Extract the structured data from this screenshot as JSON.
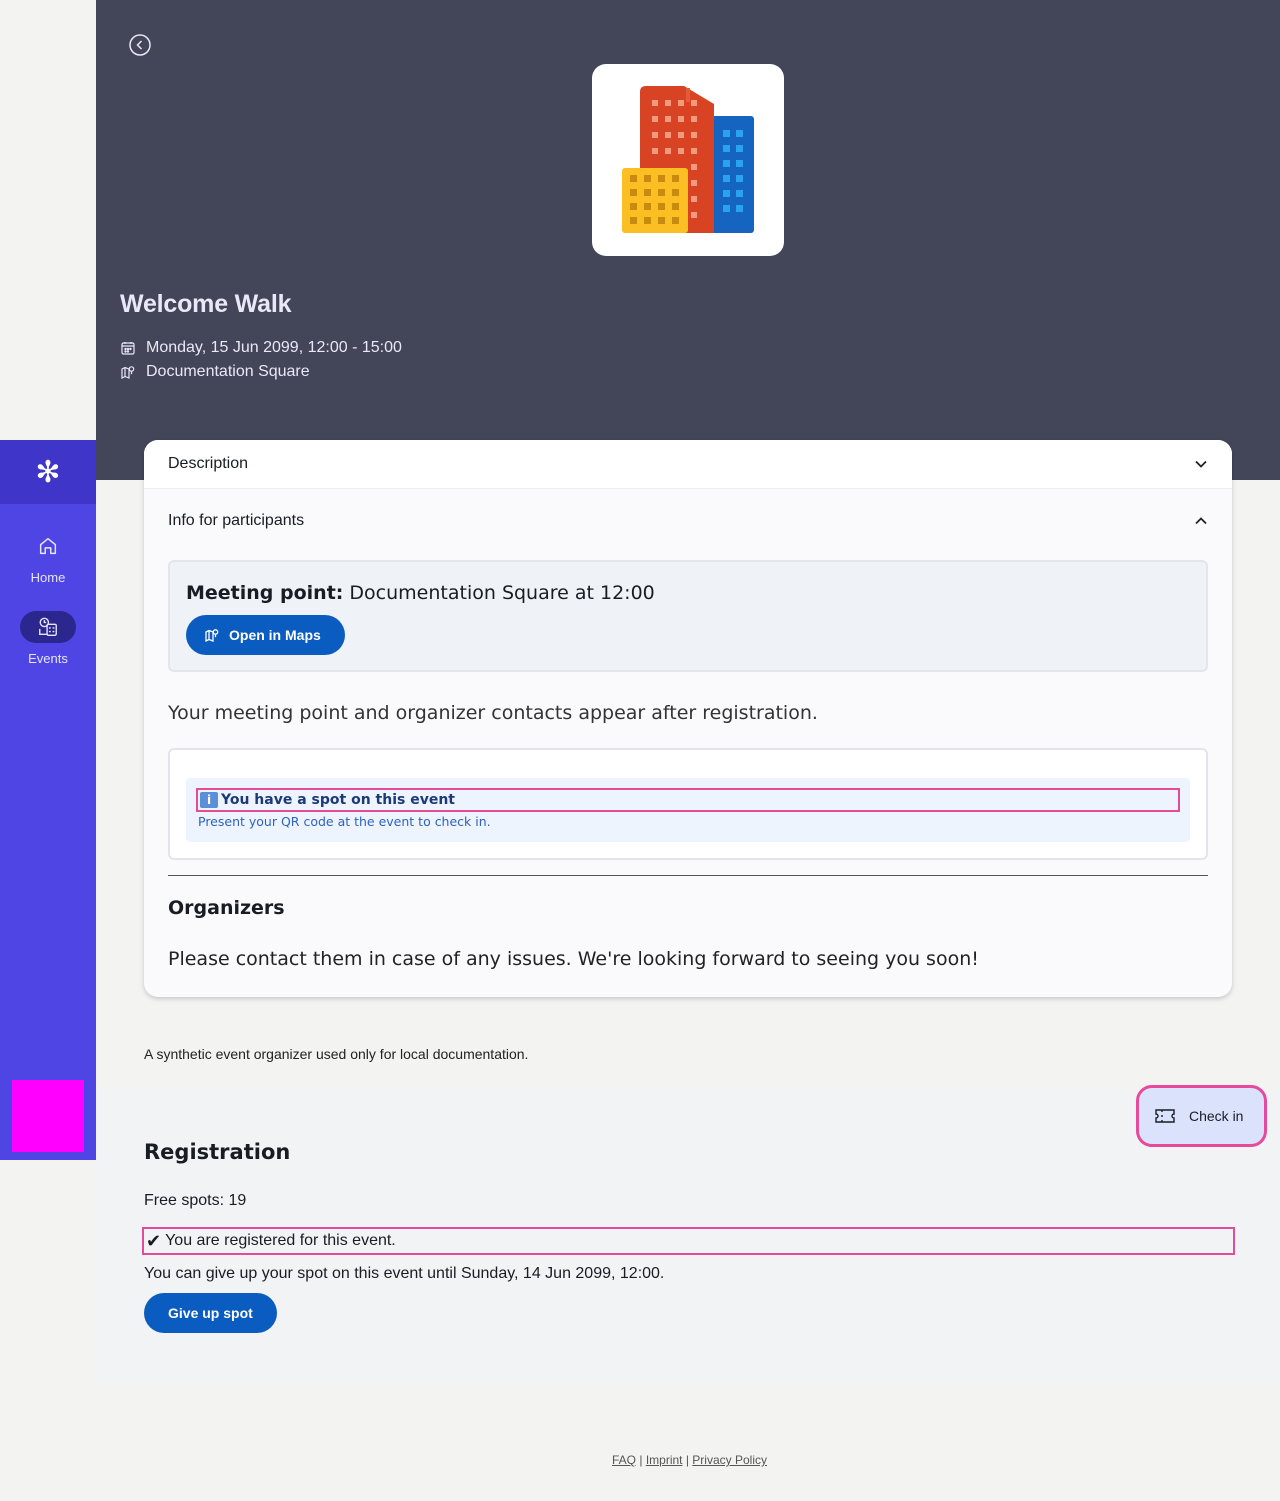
{
  "sidebar": {
    "logo": "✻",
    "items": [
      {
        "label": "Home",
        "icon": "home-icon"
      },
      {
        "label": "Events",
        "icon": "events-icon"
      }
    ]
  },
  "event": {
    "title": "Welcome Walk",
    "date": "Monday, 15 Jun 2099, 12:00 - 15:00",
    "location": "Documentation Square",
    "image_icon": "city-buildings-icon"
  },
  "accordion": {
    "description_label": "Description",
    "info_label": "Info for participants"
  },
  "meeting": {
    "label": "Meeting point:",
    "value": " Documentation Square at 12:00",
    "maps_button": "Open in Maps"
  },
  "registration_hint": "Your meeting point and organizer contacts appear after registration.",
  "spot_notice": {
    "icon": "i",
    "title": "You have a spot on this event",
    "subtitle": "Present your QR code at the event to check in."
  },
  "organizers": {
    "title": "Organizers",
    "text": "Please contact them in case of any issues. We're looking forward to seeing you soon!",
    "description": "A synthetic event organizer used only for local documentation."
  },
  "registration": {
    "title": "Registration",
    "free_spots": "Free spots: 19",
    "status_mark": "✔",
    "status": "You are registered for this event.",
    "give_up_text": "You can give up your spot on this event until Sunday, 14 Jun 2099, 12:00.",
    "give_up_button": "Give up spot"
  },
  "check_in": {
    "label": "Check in"
  },
  "footer": {
    "faq": "FAQ",
    "imprint": "Imprint",
    "privacy": "Privacy Policy",
    "separator": " | "
  },
  "colors": {
    "sidebar": "#4e45e4",
    "hero": "#434659",
    "primary_button": "#0b5cc0",
    "highlight": "#e64a9a",
    "placeholder": "#ff00ff"
  }
}
